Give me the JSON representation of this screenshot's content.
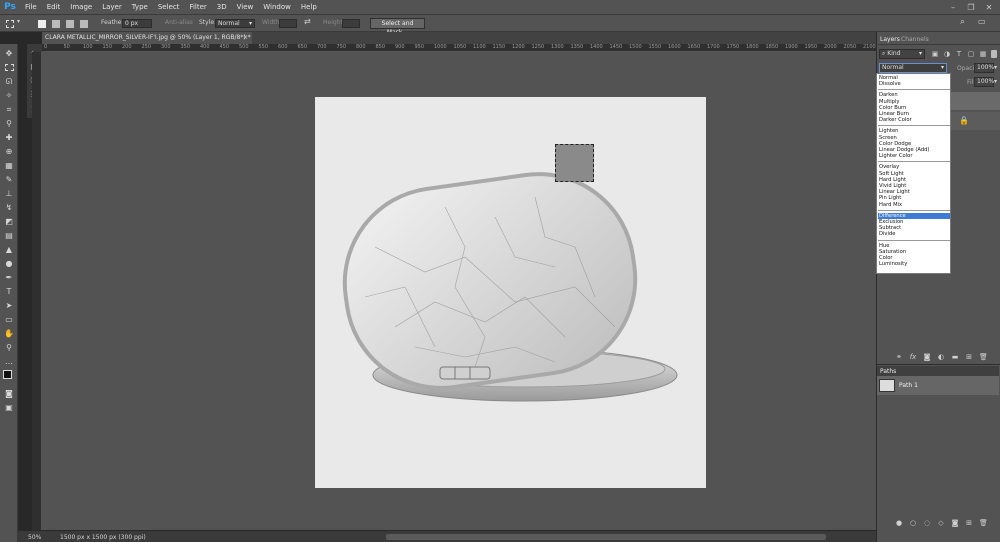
{
  "app": {
    "logo": "Ps"
  },
  "menu": [
    "File",
    "Edit",
    "Image",
    "Layer",
    "Type",
    "Select",
    "Filter",
    "3D",
    "View",
    "Window",
    "Help"
  ],
  "window_controls": [
    "–",
    "❐",
    "✕"
  ],
  "options_bar": {
    "feather_label": "Feather:",
    "feather_value": "0 px",
    "antialias_label": "Anti-alias",
    "style_label": "Style:",
    "style_value": "Normal",
    "width_label": "Width:",
    "height_label": "Height:",
    "select_mask_label": "Select and Mask..."
  },
  "document": {
    "tab_title": "CLARA METALLIC_MIRROR_SILVER-IF'I.jpg @ 50% (Layer 1, RGB/8*) *",
    "tab_close": "×"
  },
  "ruler_ticks": [
    "0",
    "50",
    "100",
    "150",
    "200",
    "250",
    "300",
    "350",
    "400",
    "450",
    "500",
    "550",
    "600",
    "650",
    "700",
    "750",
    "800",
    "850",
    "900",
    "950",
    "1000",
    "1050",
    "1100",
    "1150",
    "1200",
    "1250",
    "1300",
    "1350",
    "1400",
    "1450",
    "1500",
    "1550",
    "1600",
    "1650",
    "1700",
    "1750",
    "1800",
    "1850",
    "1900",
    "1950",
    "2000",
    "2050",
    "2100"
  ],
  "status": {
    "zoom": "50%",
    "doc_info": "1500 px x 1500 px (300 ppi)"
  },
  "layers_panel": {
    "tabs": [
      "Layers",
      "Channels"
    ],
    "kind_label": "Kind",
    "blend_mode": "Normal",
    "opacity_label": "Opacity:",
    "opacity_value": "100%",
    "fill_label": "Fill:",
    "fill_value": "100%"
  },
  "blend_modes": [
    [
      "Normal",
      "Dissolve"
    ],
    [
      "Darken",
      "Multiply",
      "Color Burn",
      "Linear Burn",
      "Darker Color"
    ],
    [
      "Lighten",
      "Screen",
      "Color Dodge",
      "Linear Dodge (Add)",
      "Lighter Color"
    ],
    [
      "Overlay",
      "Soft Light",
      "Hard Light",
      "Vivid Light",
      "Linear Light",
      "Pin Light",
      "Hard Mix"
    ],
    [
      "Difference",
      "Exclusion",
      "Subtract",
      "Divide"
    ],
    [
      "Hue",
      "Saturation",
      "Color",
      "Luminosity"
    ]
  ],
  "blend_selected": "Difference",
  "paths_panel": {
    "tab": "Paths",
    "path_name": "Path 1"
  },
  "colors": {
    "ui_dark": "#282828",
    "ui_mid": "#535353",
    "canvas_bg": "#535353",
    "doc_bg": "#e9e9e9",
    "accent": "#3d7bd4",
    "ps_blue": "#31a8ff"
  }
}
